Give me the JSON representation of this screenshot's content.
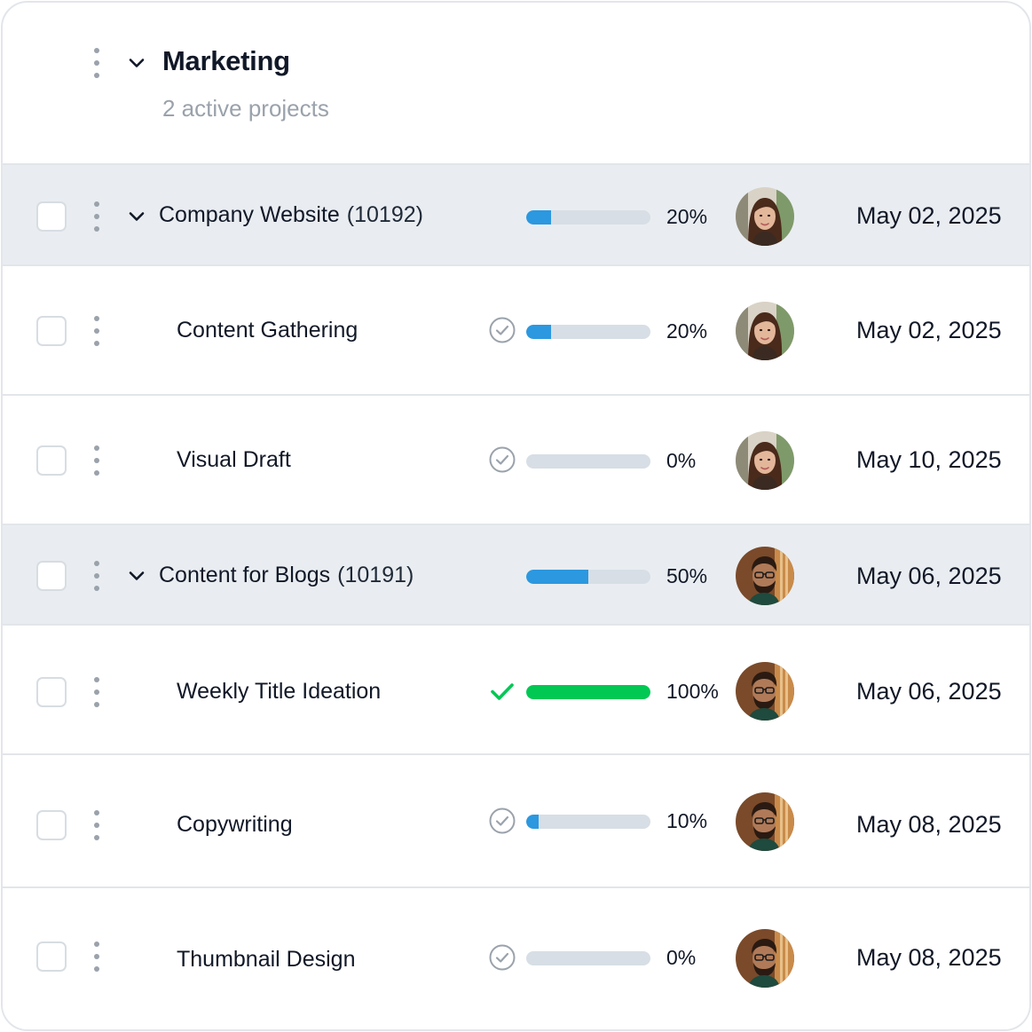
{
  "group": {
    "title": "Marketing",
    "subtitle": "2 active projects"
  },
  "colors": {
    "progress_blue": "#2b98e0",
    "progress_green": "#00c853",
    "track": "#d7dee5",
    "parent_row_bg": "#e9edf1"
  },
  "rows": [
    {
      "type": "project",
      "name": "Company Website",
      "code": "(10192)",
      "progress": 20,
      "progress_label": "20%",
      "assignee": "woman-avatar",
      "date": "May 02, 2025"
    },
    {
      "type": "task",
      "name": "Content Gathering",
      "status": "pending",
      "progress": 20,
      "progress_label": "20%",
      "assignee": "woman-avatar",
      "date": "May 02, 2025"
    },
    {
      "type": "task",
      "name": "Visual Draft",
      "status": "pending",
      "progress": 0,
      "progress_label": "0%",
      "assignee": "woman-avatar",
      "date": "May 10, 2025"
    },
    {
      "type": "project",
      "name": "Content for Blogs",
      "code": "(10191)",
      "progress": 50,
      "progress_label": "50%",
      "assignee": "man-avatar",
      "date": "May 06, 2025"
    },
    {
      "type": "task",
      "name": "Weekly Title Ideation",
      "status": "complete",
      "progress": 100,
      "progress_label": "100%",
      "assignee": "man-avatar",
      "date": "May 06, 2025"
    },
    {
      "type": "task",
      "name": "Copywriting",
      "status": "pending",
      "progress": 10,
      "progress_label": "10%",
      "assignee": "man-avatar",
      "date": "May 08, 2025"
    },
    {
      "type": "task",
      "name": "Thumbnail Design",
      "status": "pending",
      "progress": 0,
      "progress_label": "0%",
      "assignee": "man-avatar",
      "date": "May 08, 2025"
    }
  ]
}
